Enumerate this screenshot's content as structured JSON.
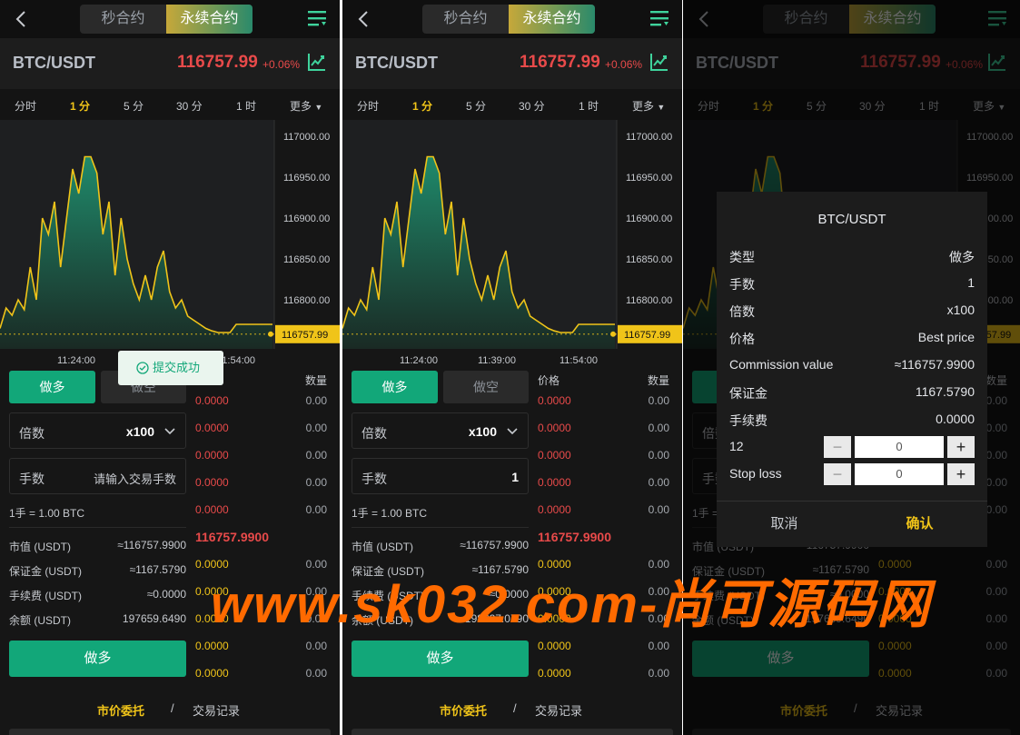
{
  "header": {
    "tabs": [
      "秒合约",
      "永续合约"
    ],
    "active_tab": "永续合约"
  },
  "pair": {
    "symbol": "BTC/USDT",
    "price": "116757.99",
    "change": "+0.06%"
  },
  "timeframes": [
    "分时",
    "1 分",
    "5 分",
    "30 分",
    "1 时",
    "更多"
  ],
  "timeframe_more_suffix": "▼",
  "active_timeframe": "1 分",
  "chart_data": {
    "type": "area",
    "series": [
      {
        "values": [
          116765,
          116790,
          116781,
          116800,
          116788,
          116840,
          116800,
          116900,
          116880,
          116920,
          116840,
          116900,
          116960,
          116930,
          116975,
          116975,
          116955,
          116880,
          116920,
          116830,
          116900,
          116850,
          116820,
          116800,
          116830,
          116800,
          116840,
          116860,
          116810,
          116790,
          116800,
          116780,
          116775,
          116770,
          116765,
          116762,
          116760,
          116760,
          116760,
          116770,
          116770,
          116770,
          116770,
          116770,
          116770,
          116770
        ]
      }
    ],
    "x_ticks": [
      "11:24:00",
      "11:39:00",
      "11:54:00"
    ],
    "y_ticks": [
      "117000.00",
      "116950.00",
      "116900.00",
      "116850.00",
      "116800.00"
    ],
    "ylim": [
      116740,
      117020
    ],
    "last_price_label": "116757.99",
    "colors": {
      "line": "#f0c419",
      "fill_top": "#1f8a6b",
      "fill_bottom": "#1a2a24"
    }
  },
  "trade": {
    "buy_tab": "做多",
    "sell_tab": "做空",
    "leverage_label": "倍数",
    "leverage_value": "x100",
    "lots_label": "手数",
    "lots_placeholder": "请输入交易手数",
    "lots_value_p2": "1",
    "lot_unit": "1手 = 1.00 BTC",
    "market_value_label": "市值 (USDT)",
    "market_value": "≈116757.9900",
    "margin_label": "保证金 (USDT)",
    "margin": "≈1167.5790",
    "fee_label": "手续费 (USDT)",
    "fee": "≈0.0000",
    "balance_label": "余额 (USDT)",
    "balance_p1": "197659.6490",
    "balance_p2": "198827.0790",
    "submit": "做多"
  },
  "orderbook": {
    "price_header": "价格",
    "qty_header": "数量",
    "zero_price": "0.0000",
    "zero_qty": "0.00",
    "last": "116757.9900"
  },
  "bottom": {
    "tab1": "市价委托",
    "sep": "/",
    "tab2": "交易记录"
  },
  "toast": {
    "text": "提交成功"
  },
  "modal": {
    "title": "BTC/USDT",
    "rows": [
      {
        "label": "类型",
        "value": "做多"
      },
      {
        "label": "手数",
        "value": "1"
      },
      {
        "label": "倍数",
        "value": "x100"
      },
      {
        "label": "价格",
        "value": "Best price"
      },
      {
        "label": "Commission value",
        "value": "≈116757.9900"
      },
      {
        "label": "保证金",
        "value": "1167.5790"
      },
      {
        "label": "手续费",
        "value": "0.0000"
      }
    ],
    "take_profit_label": "12",
    "take_profit_value": "0",
    "stop_loss_label": "Stop loss",
    "stop_loss_value": "0",
    "cancel": "取消",
    "confirm": "确认"
  },
  "watermark": "www.sk032.com-尚可源码网"
}
